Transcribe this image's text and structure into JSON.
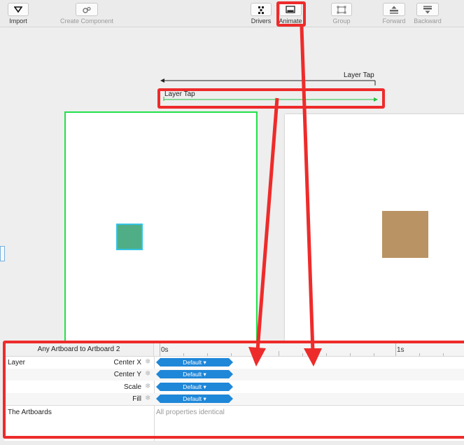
{
  "toolbar": {
    "import_label": "Import",
    "create_component_label": "Create Component",
    "drivers_label": "Drivers",
    "animate_label": "Animate",
    "group_label": "Group",
    "forward_label": "Forward",
    "backward_label": "Backward"
  },
  "canvas": {
    "connection_top_label": "Layer Tap",
    "connection_bottom_label": "Layer Tap",
    "artboard1_square_color": "#4fae86",
    "artboard2_square_color": "#b99363"
  },
  "timeline": {
    "title": "Any Artboard to Artboard 2",
    "ruler": {
      "start": "0s",
      "mark": "1s"
    },
    "layer_label": "Layer",
    "properties": [
      {
        "name": "Center X",
        "curve": "Default ▾"
      },
      {
        "name": "Center Y",
        "curve": "Default ▾"
      },
      {
        "name": "Scale",
        "curve": "Default ▾"
      },
      {
        "name": "Fill",
        "curve": "Default ▾"
      }
    ],
    "artboards_label": "The Artboards",
    "artboards_note": "All properties identical"
  },
  "colors": {
    "highlight": "#ee2b2b",
    "selected_connection": "#22e04a",
    "curve_pill": "#1f87d8"
  }
}
